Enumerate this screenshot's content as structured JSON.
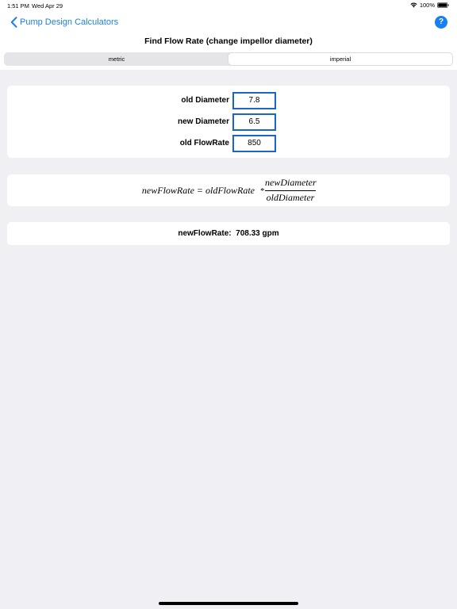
{
  "status_bar": {
    "time": "1:51 PM",
    "date": "Wed Apr 29",
    "battery": "100%",
    "icons": [
      "wifi-icon",
      "battery-icon"
    ]
  },
  "nav": {
    "back_label": "Pump Design Calculators",
    "back_icon": "chevron-left-icon",
    "help_label": "?",
    "help_icon": "question-circle-icon",
    "accent_color": "#1a7ff0"
  },
  "title": "Find Flow Rate (change impellor diameter)",
  "units": {
    "options": [
      "metric",
      "imperial"
    ],
    "selected": "imperial"
  },
  "inputs": [
    {
      "label": "old Diameter",
      "value": "7.8"
    },
    {
      "label": "new Diameter",
      "value": "6.5"
    },
    {
      "label": "old FlowRate",
      "value": "850"
    }
  ],
  "formula": {
    "lhs": "newFlowRate = oldFlowRate",
    "operator": "*",
    "numerator": "newDiameter",
    "denominator": "oldDiameter"
  },
  "result": {
    "label": "newFlowRate:",
    "value": "708.33 gpm"
  }
}
